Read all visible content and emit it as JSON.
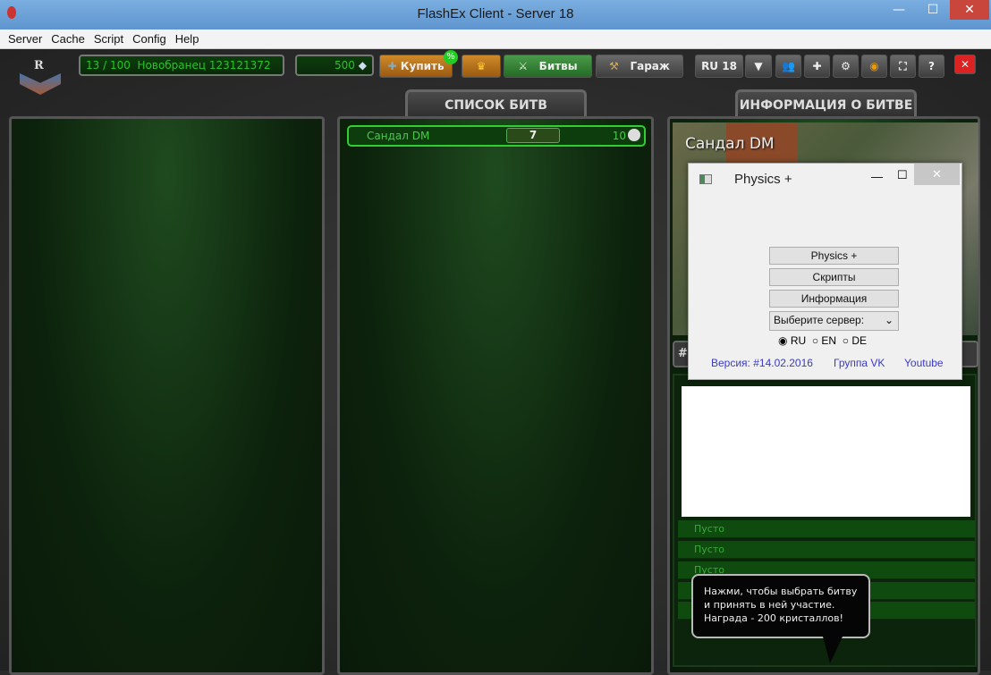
{
  "window": {
    "title": "FlashEx Client - Server 18",
    "minimize": "—",
    "maximize": "☐",
    "close": "✕"
  },
  "menu": [
    "Server",
    "Cache",
    "Script",
    "Config",
    "Help"
  ],
  "toolbar": {
    "rank_letter": "R",
    "xp": "13 / 100",
    "rank_name": "Новобранец 123121372",
    "crystals": "500",
    "buy": "Купить",
    "buy_badge": "%",
    "battles": "Битвы",
    "garage": "Гараж",
    "server": "RU 18",
    "help": "?",
    "exit": "✕"
  },
  "tabs": {
    "battle_list": "СПИСОК БИТВ",
    "battle_info": "ИНФОРМАЦИЯ О БИТВЕ"
  },
  "battles": [
    {
      "name": "Сандал DM",
      "players": "7",
      "limit": "10"
    }
  ],
  "info": {
    "map_name": "Сандал DM",
    "header_partial": "#/",
    "slots": [
      "Пусто",
      "Пусто",
      "Пусто"
    ]
  },
  "tooltip": "Нажми, чтобы выбрать битву и принять в ней участие. Награда - 200 кристаллов!",
  "dialog": {
    "title": "Physics +",
    "buttons": [
      "Physics +",
      "Скрипты",
      "Информация"
    ],
    "server_select": "Выберите сервер:",
    "radios": [
      {
        "label": "RU",
        "checked": true
      },
      {
        "label": "EN",
        "checked": false
      },
      {
        "label": "DE",
        "checked": false
      }
    ],
    "version": "Версия: #14.02.2016",
    "vk": "Группа VK",
    "youtube": "Youtube"
  }
}
